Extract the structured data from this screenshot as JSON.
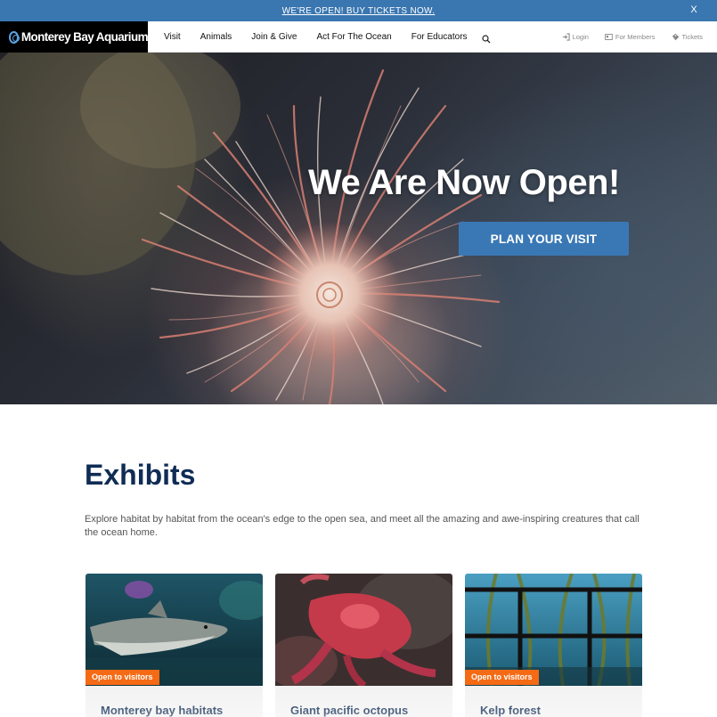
{
  "announcement": {
    "text": "WE'RE OPEN! BUY TICKETS NOW.",
    "close_label": "X"
  },
  "nav": {
    "logo_text": "Monterey Bay Aquarium",
    "items": [
      {
        "label": "Visit"
      },
      {
        "label": "Animals"
      },
      {
        "label": "Join & Give"
      },
      {
        "label": "Act For The Ocean"
      },
      {
        "label": "For Educators"
      }
    ],
    "utility": [
      {
        "label": "Login",
        "icon": "login-icon"
      },
      {
        "label": "For Members",
        "icon": "member-card-icon"
      },
      {
        "label": "Tickets",
        "icon": "ticket-icon"
      }
    ]
  },
  "hero": {
    "headline": "We Are Now Open!",
    "cta_label": "PLAN YOUR VISIT"
  },
  "exhibits": {
    "title": "Exhibits",
    "description": "Explore habitat by habitat from the ocean's edge to the open sea, and meet all the amazing and awe-inspiring creatures that call the ocean home.",
    "cards": [
      {
        "title": "Monterey bay habitats",
        "badge": "Open to visitors"
      },
      {
        "title": "Giant pacific octopus",
        "badge": ""
      },
      {
        "title": "Kelp forest",
        "badge": "Open to visitors"
      }
    ]
  },
  "colors": {
    "accent_blue": "#3a78b5",
    "navy": "#0f2c54",
    "badge_orange": "#f56a14"
  }
}
